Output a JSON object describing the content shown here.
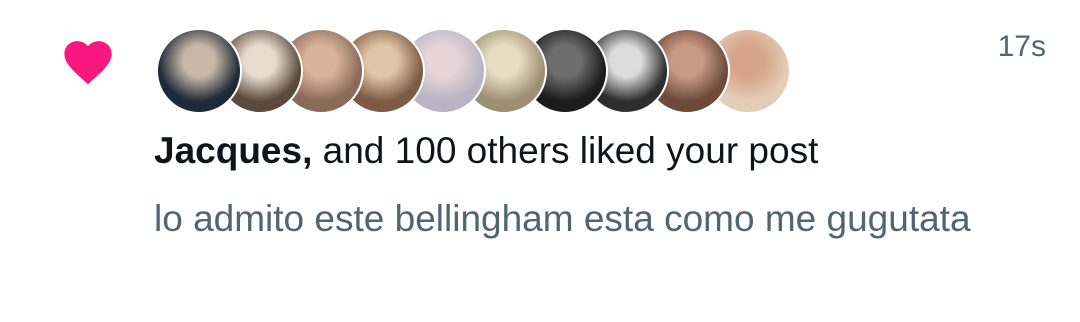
{
  "notification": {
    "heart_color": "#f91880",
    "timestamp": "17s",
    "liker_name": "Jacques,",
    "liked_text": " and 100 others liked your post",
    "post_text": "lo admito este bellingham esta como me gugutata",
    "avatars": [
      {
        "bg": "#1f2a38",
        "accent": "#c9b8a8"
      },
      {
        "bg": "#5a4a3c",
        "accent": "#e8dccf"
      },
      {
        "bg": "#8a6a58",
        "accent": "#d8b49a"
      },
      {
        "bg": "#7b5b44",
        "accent": "#e2c4a6"
      },
      {
        "bg": "#b8b4c4",
        "accent": "#e6d4d8"
      },
      {
        "bg": "#9c8f74",
        "accent": "#e8dcc2"
      },
      {
        "bg": "#1c1c1c",
        "accent": "#6e6e6e"
      },
      {
        "bg": "#2e2e2e",
        "accent": "#dcdcdc"
      },
      {
        "bg": "#6b4a3a",
        "accent": "#c89a84"
      },
      {
        "bg": "#e4cdb8",
        "accent": "#d6a48a"
      }
    ]
  }
}
